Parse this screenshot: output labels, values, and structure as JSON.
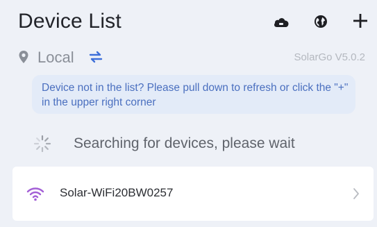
{
  "header": {
    "title": "Device List",
    "icons": [
      "cloud-icon",
      "globe-icon",
      "plus-icon"
    ]
  },
  "location": {
    "label": "Local",
    "version": "SolarGo V5.0.2"
  },
  "tip": {
    "text": "Device not in the list? Please pull down to refresh or click the \"+\" in the upper right corner"
  },
  "search": {
    "status": "Searching for devices, please wait"
  },
  "devices": [
    {
      "name": "Solar-WiFi20BW0257"
    }
  ],
  "colors": {
    "background": "#eef1f7",
    "tip_background": "#e3ebf8",
    "tip_text": "#4a6fbf",
    "wifi_accent": "#a35fd6",
    "switch_accent": "#3d6fd9"
  }
}
